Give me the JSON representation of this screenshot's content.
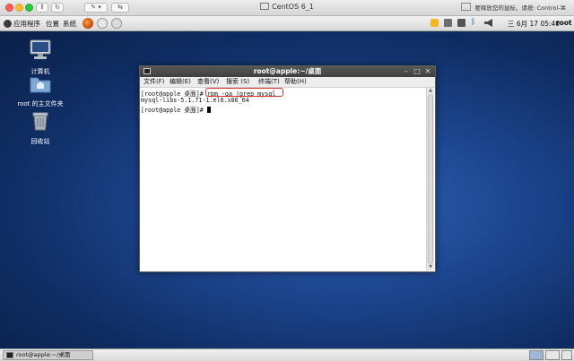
{
  "vm_window": {
    "title": "CentOS 6_1",
    "hint": "要释放您的鼠标，请按: Control-⌘"
  },
  "top_panel": {
    "menus": [
      "应用程序",
      "位置",
      "系统"
    ],
    "clock": "三 6月 17 05:40",
    "user": "root"
  },
  "desktop_icons": [
    {
      "label": "计算机",
      "icon": "computer-icon"
    },
    {
      "label": "root 的主文件夹",
      "icon": "home-folder-icon"
    },
    {
      "label": "回收站",
      "icon": "trash-icon"
    }
  ],
  "terminal": {
    "title": "root@apple:~/桌面",
    "menu": [
      "文件(F)",
      "编辑(E)",
      "查看(V)",
      "搜索 (S)",
      "终端(T)",
      "帮助(H)"
    ],
    "lines": [
      {
        "prompt": "[root@apple 桌面]# ",
        "command": "rpm -qa |grep mysql"
      },
      {
        "output": "mysql-libs-5.1.71-1.el6.x86_64"
      },
      {
        "prompt": "[root@apple 桌面]# ",
        "command": ""
      }
    ],
    "highlight_color": "#d2362f"
  },
  "taskbar": {
    "task_label": "root@apple:~/桌面"
  }
}
